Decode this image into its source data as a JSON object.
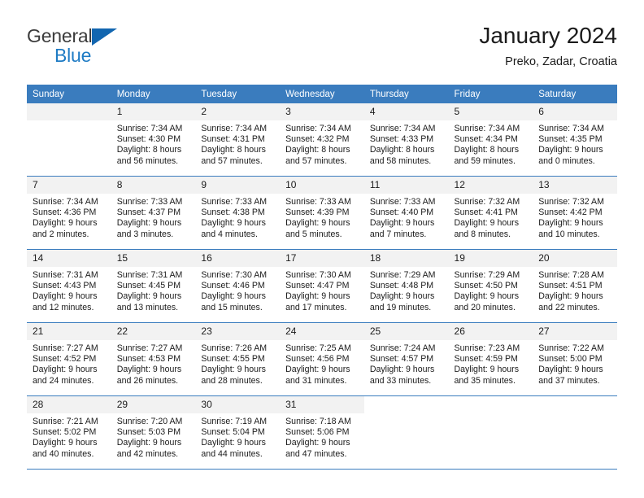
{
  "brand": {
    "name_top": "General",
    "name_bottom": "Blue",
    "triangle_color": "#1266b0",
    "blue_color": "#1e7bc4"
  },
  "header": {
    "title": "January 2024",
    "subtitle": "Preko, Zadar, Croatia"
  },
  "theme": {
    "header_blue": "#3a7cbe",
    "daynum_band": "#f2f2f2"
  },
  "calendar": {
    "weekday_headers": [
      "Sunday",
      "Monday",
      "Tuesday",
      "Wednesday",
      "Thursday",
      "Friday",
      "Saturday"
    ],
    "weeks": [
      [
        {
          "day": "",
          "lines": []
        },
        {
          "day": "1",
          "lines": [
            "Sunrise: 7:34 AM",
            "Sunset: 4:30 PM",
            "Daylight: 8 hours",
            "and 56 minutes."
          ]
        },
        {
          "day": "2",
          "lines": [
            "Sunrise: 7:34 AM",
            "Sunset: 4:31 PM",
            "Daylight: 8 hours",
            "and 57 minutes."
          ]
        },
        {
          "day": "3",
          "lines": [
            "Sunrise: 7:34 AM",
            "Sunset: 4:32 PM",
            "Daylight: 8 hours",
            "and 57 minutes."
          ]
        },
        {
          "day": "4",
          "lines": [
            "Sunrise: 7:34 AM",
            "Sunset: 4:33 PM",
            "Daylight: 8 hours",
            "and 58 minutes."
          ]
        },
        {
          "day": "5",
          "lines": [
            "Sunrise: 7:34 AM",
            "Sunset: 4:34 PM",
            "Daylight: 8 hours",
            "and 59 minutes."
          ]
        },
        {
          "day": "6",
          "lines": [
            "Sunrise: 7:34 AM",
            "Sunset: 4:35 PM",
            "Daylight: 9 hours",
            "and 0 minutes."
          ]
        }
      ],
      [
        {
          "day": "7",
          "lines": [
            "Sunrise: 7:34 AM",
            "Sunset: 4:36 PM",
            "Daylight: 9 hours",
            "and 2 minutes."
          ]
        },
        {
          "day": "8",
          "lines": [
            "Sunrise: 7:33 AM",
            "Sunset: 4:37 PM",
            "Daylight: 9 hours",
            "and 3 minutes."
          ]
        },
        {
          "day": "9",
          "lines": [
            "Sunrise: 7:33 AM",
            "Sunset: 4:38 PM",
            "Daylight: 9 hours",
            "and 4 minutes."
          ]
        },
        {
          "day": "10",
          "lines": [
            "Sunrise: 7:33 AM",
            "Sunset: 4:39 PM",
            "Daylight: 9 hours",
            "and 5 minutes."
          ]
        },
        {
          "day": "11",
          "lines": [
            "Sunrise: 7:33 AM",
            "Sunset: 4:40 PM",
            "Daylight: 9 hours",
            "and 7 minutes."
          ]
        },
        {
          "day": "12",
          "lines": [
            "Sunrise: 7:32 AM",
            "Sunset: 4:41 PM",
            "Daylight: 9 hours",
            "and 8 minutes."
          ]
        },
        {
          "day": "13",
          "lines": [
            "Sunrise: 7:32 AM",
            "Sunset: 4:42 PM",
            "Daylight: 9 hours",
            "and 10 minutes."
          ]
        }
      ],
      [
        {
          "day": "14",
          "lines": [
            "Sunrise: 7:31 AM",
            "Sunset: 4:43 PM",
            "Daylight: 9 hours",
            "and 12 minutes."
          ]
        },
        {
          "day": "15",
          "lines": [
            "Sunrise: 7:31 AM",
            "Sunset: 4:45 PM",
            "Daylight: 9 hours",
            "and 13 minutes."
          ]
        },
        {
          "day": "16",
          "lines": [
            "Sunrise: 7:30 AM",
            "Sunset: 4:46 PM",
            "Daylight: 9 hours",
            "and 15 minutes."
          ]
        },
        {
          "day": "17",
          "lines": [
            "Sunrise: 7:30 AM",
            "Sunset: 4:47 PM",
            "Daylight: 9 hours",
            "and 17 minutes."
          ]
        },
        {
          "day": "18",
          "lines": [
            "Sunrise: 7:29 AM",
            "Sunset: 4:48 PM",
            "Daylight: 9 hours",
            "and 19 minutes."
          ]
        },
        {
          "day": "19",
          "lines": [
            "Sunrise: 7:29 AM",
            "Sunset: 4:50 PM",
            "Daylight: 9 hours",
            "and 20 minutes."
          ]
        },
        {
          "day": "20",
          "lines": [
            "Sunrise: 7:28 AM",
            "Sunset: 4:51 PM",
            "Daylight: 9 hours",
            "and 22 minutes."
          ]
        }
      ],
      [
        {
          "day": "21",
          "lines": [
            "Sunrise: 7:27 AM",
            "Sunset: 4:52 PM",
            "Daylight: 9 hours",
            "and 24 minutes."
          ]
        },
        {
          "day": "22",
          "lines": [
            "Sunrise: 7:27 AM",
            "Sunset: 4:53 PM",
            "Daylight: 9 hours",
            "and 26 minutes."
          ]
        },
        {
          "day": "23",
          "lines": [
            "Sunrise: 7:26 AM",
            "Sunset: 4:55 PM",
            "Daylight: 9 hours",
            "and 28 minutes."
          ]
        },
        {
          "day": "24",
          "lines": [
            "Sunrise: 7:25 AM",
            "Sunset: 4:56 PM",
            "Daylight: 9 hours",
            "and 31 minutes."
          ]
        },
        {
          "day": "25",
          "lines": [
            "Sunrise: 7:24 AM",
            "Sunset: 4:57 PM",
            "Daylight: 9 hours",
            "and 33 minutes."
          ]
        },
        {
          "day": "26",
          "lines": [
            "Sunrise: 7:23 AM",
            "Sunset: 4:59 PM",
            "Daylight: 9 hours",
            "and 35 minutes."
          ]
        },
        {
          "day": "27",
          "lines": [
            "Sunrise: 7:22 AM",
            "Sunset: 5:00 PM",
            "Daylight: 9 hours",
            "and 37 minutes."
          ]
        }
      ],
      [
        {
          "day": "28",
          "lines": [
            "Sunrise: 7:21 AM",
            "Sunset: 5:02 PM",
            "Daylight: 9 hours",
            "and 40 minutes."
          ]
        },
        {
          "day": "29",
          "lines": [
            "Sunrise: 7:20 AM",
            "Sunset: 5:03 PM",
            "Daylight: 9 hours",
            "and 42 minutes."
          ]
        },
        {
          "day": "30",
          "lines": [
            "Sunrise: 7:19 AM",
            "Sunset: 5:04 PM",
            "Daylight: 9 hours",
            "and 44 minutes."
          ]
        },
        {
          "day": "31",
          "lines": [
            "Sunrise: 7:18 AM",
            "Sunset: 5:06 PM",
            "Daylight: 9 hours",
            "and 47 minutes."
          ]
        },
        {
          "day": "",
          "lines": []
        },
        {
          "day": "",
          "lines": []
        },
        {
          "day": "",
          "lines": []
        }
      ]
    ]
  }
}
